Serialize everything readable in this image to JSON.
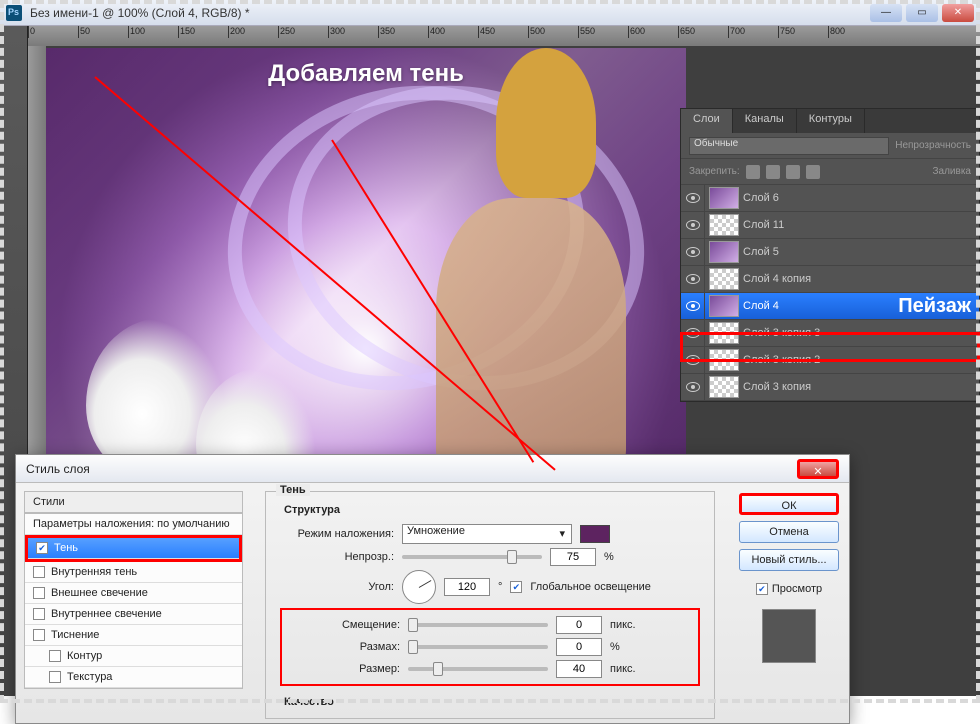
{
  "window": {
    "title": "Без имени-1 @ 100% (Слой 4, RGB/8) *"
  },
  "ruler_ticks": [
    "0",
    "50",
    "100",
    "150",
    "200",
    "250",
    "300",
    "350",
    "400",
    "450",
    "500",
    "550",
    "600",
    "650",
    "700",
    "750",
    "800"
  ],
  "canvas": {
    "heading": "Добавляем тень"
  },
  "layers_panel": {
    "tabs": [
      "Слои",
      "Каналы",
      "Контуры"
    ],
    "blend_mode": "Обычные",
    "opacity_label": "Непрозрачность",
    "lock_label": "Закрепить:",
    "fill_label": "Заливка",
    "layers": [
      {
        "name": "Слой 6",
        "thumb": "purple"
      },
      {
        "name": "Слой 11",
        "thumb": "checker"
      },
      {
        "name": "Слой 5",
        "thumb": "purple"
      },
      {
        "name": "Слой 4 копия",
        "thumb": "checker"
      },
      {
        "name": "Слой 4",
        "thumb": "purple",
        "selected": true,
        "annotation": "Пейзаж"
      },
      {
        "name": "Слой 3 копия 3",
        "thumb": "checker"
      },
      {
        "name": "Слой 3 копия 2",
        "thumb": "checker"
      },
      {
        "name": "Слой 3 копия",
        "thumb": "checker"
      }
    ]
  },
  "dialog": {
    "title": "Стиль слоя",
    "styles_header": "Стили",
    "blending_defaults": "Параметры наложения: по умолчанию",
    "style_items": [
      {
        "label": "Тень",
        "checked": true,
        "selected": true
      },
      {
        "label": "Внутренняя тень",
        "checked": false
      },
      {
        "label": "Внешнее свечение",
        "checked": false
      },
      {
        "label": "Внутреннее свечение",
        "checked": false
      },
      {
        "label": "Тиснение",
        "checked": false
      },
      {
        "label": "Контур",
        "checked": false,
        "indent": true
      },
      {
        "label": "Текстура",
        "checked": false,
        "indent": true
      }
    ],
    "shadow": {
      "group_title": "Тень",
      "structure_title": "Структура",
      "blend_label": "Режим наложения:",
      "blend_value": "Умножение",
      "opacity_label": "Непрозр.:",
      "opacity_value": "75",
      "opacity_unit": "%",
      "angle_label": "Угол:",
      "angle_value": "120",
      "angle_unit": "°",
      "global_light": "Глобальное освещение",
      "distance_label": "Смещение:",
      "distance_value": "0",
      "distance_unit": "пикс.",
      "spread_label": "Размах:",
      "spread_value": "0",
      "spread_unit": "%",
      "size_label": "Размер:",
      "size_value": "40",
      "size_unit": "пикс.",
      "quality_title": "Качество"
    },
    "buttons": {
      "ok": "ОК",
      "cancel": "Отмена",
      "new_style": "Новый стиль...",
      "preview": "Просмотр"
    },
    "close": "✕"
  }
}
